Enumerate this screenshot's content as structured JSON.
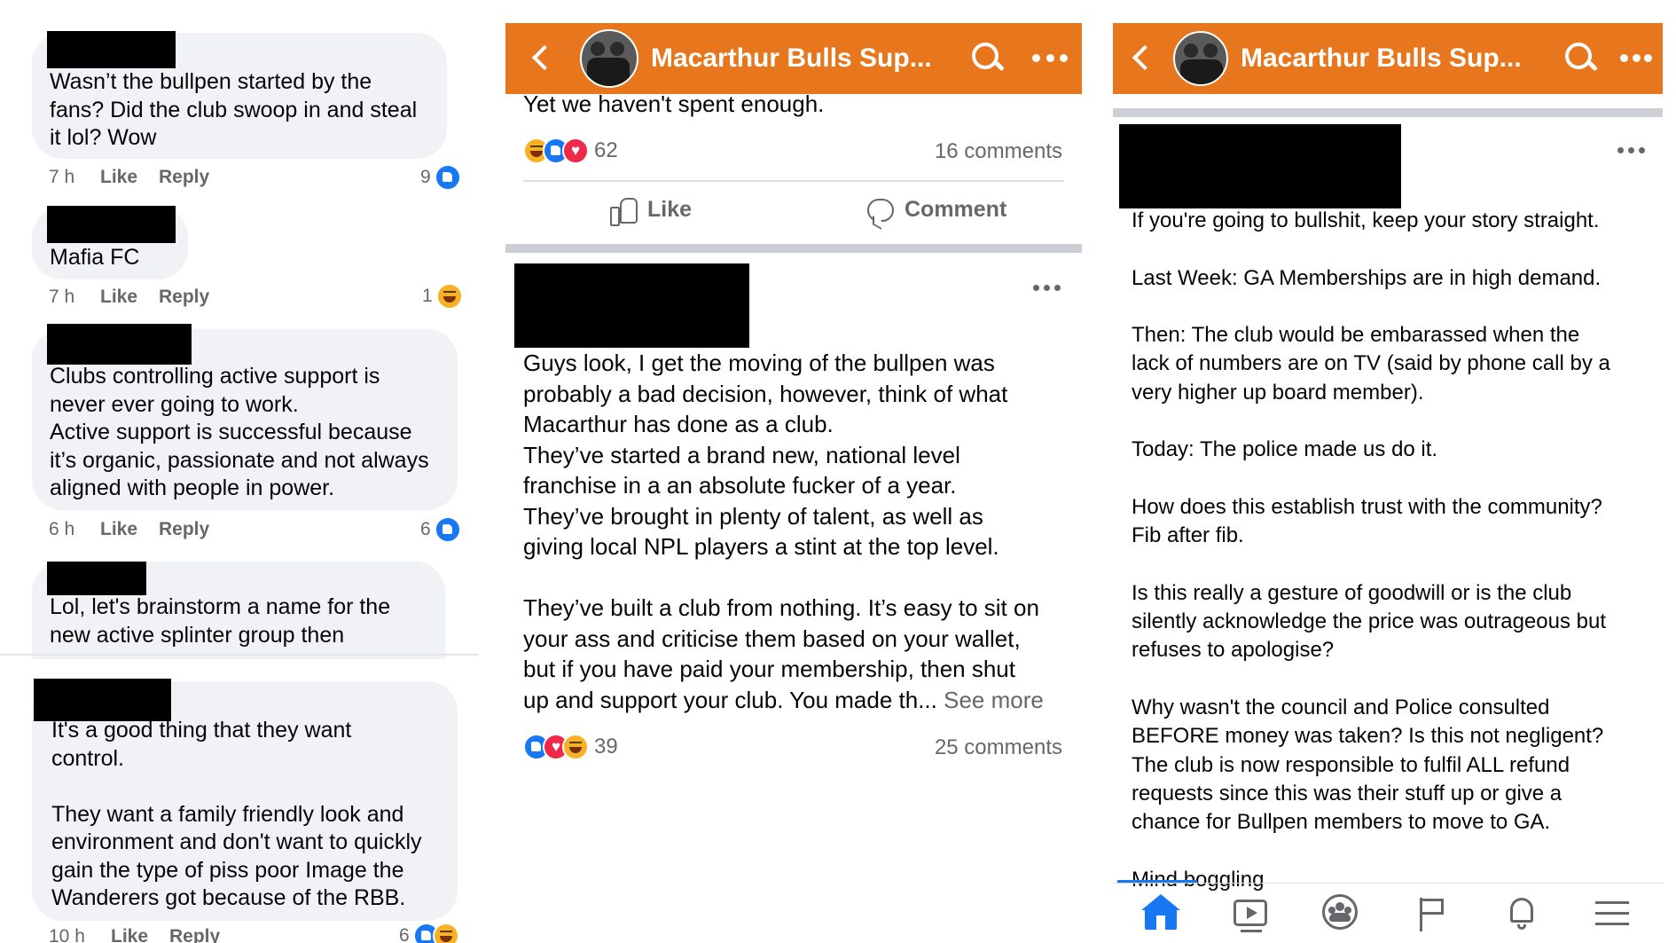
{
  "comments": [
    {
      "text": "Wasn’t the bullpen started by the\nfans? Did the club swoop in and steal\nit lol? Wow",
      "time": "7 h",
      "like": "Like",
      "reply": "Reply",
      "count": "9",
      "reactions": [
        "like"
      ]
    },
    {
      "text": "Mafia FC",
      "time": "7 h",
      "like": "Like",
      "reply": "Reply",
      "count": "1",
      "reactions": [
        "haha"
      ]
    },
    {
      "text": "Clubs controlling active support is\nnever ever going to work.\nActive support is successful because\nit’s organic, passionate and not always\naligned with people in power.",
      "time": "6 h",
      "like": "Like",
      "reply": "Reply",
      "count": "6",
      "reactions": [
        "like"
      ]
    },
    {
      "text": "Lol, let's brainstorm a name for the\nnew active splinter group then"
    },
    {
      "text": "It's a good thing that they want\ncontrol.\n\nThey want a family friendly look and\nenvironment and don't want to quickly\ngain the type of piss poor Image the\nWanderers got because of the RBB.",
      "time": "10 h",
      "like": "Like",
      "reply": "Reply",
      "count": "6",
      "reactions": [
        "like",
        "haha"
      ]
    }
  ],
  "header": {
    "title": "Macarthur Bulls Sup..."
  },
  "post1": {
    "text_tail": "Yet we haven't spent enough.",
    "reaction_count": "62",
    "comments": "16 comments",
    "like_label": "Like",
    "comment_label": "Comment"
  },
  "post2": {
    "text": "Guys look, I get the moving of the bullpen was\nprobably a bad decision, however, think of what\nMacarthur has done as a club.\nThey’ve started a brand new, national level\nfranchise in a an absolute fucker of a year.\nThey’ve brought in plenty of talent, as well as\ngiving local NPL players a stint at the top level.\n\nThey’ve built a club from nothing. It’s easy to sit on\nyour ass and criticise them based on your wallet,\nbut if you have paid your membership, then shut\nup and support your club. You made th...",
    "see_more": "See more",
    "reaction_count": "39",
    "comments": "25 comments"
  },
  "post3": {
    "text": "If you're going to bullshit, keep your story straight.\n\nLast Week: GA Memberships are in high demand.\n\nThen: The club would be embarassed when the\nlack of numbers are on TV (said by phone call by a\nvery higher up board member).\n\nToday: The police made us do it.\n\nHow does this establish trust with the community?\nFib after fib.\n\nIs this really a gesture of goodwill or is the club\nsilently acknowledge the price was outrageous but\nrefuses to apologise?\n\nWhy wasn't the council and Police consulted\nBEFORE money was taken? Is this not negligent?\nThe club is now responsible to fulfil ALL refund\nrequests since this was their stuff up or give a\nchance for Bullpen members to move to GA.\n\nMind boggling"
  },
  "nav": [
    "home-icon",
    "watch-icon",
    "groups-icon",
    "pages-icon",
    "notifications-icon",
    "menu-icon"
  ],
  "colors": {
    "header": "#e8761c",
    "accent": "#1877f2",
    "bubble": "#f0f2f5"
  }
}
